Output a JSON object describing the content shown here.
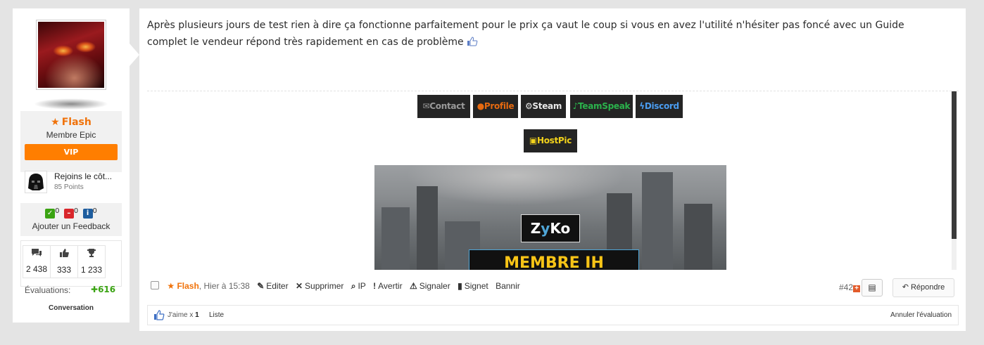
{
  "post": {
    "text": "Après plusieurs jours de test rien à dire ça fonctionne parfaitement pour le prix ça vaut le coup si vous en avez l'utilité n'hésiter pas foncé avec un Guide complet le vendeur répond très rapidement en cas de problème",
    "emoji": "thumbs-up"
  },
  "user": {
    "name": "Flash",
    "title": "Membre Epic",
    "badge": "VIP",
    "rank_label": "Rejoins le côt...",
    "rank_points": "85 Points",
    "feedback": {
      "positive": "0",
      "negative": "0",
      "neutral": "0",
      "link": "Ajouter un Feedback"
    },
    "stats": {
      "messages": "2 438",
      "likes": "333",
      "trophies": "1 233"
    },
    "evaluations_label": "Évaluations:",
    "evaluations_value": "616",
    "conversation": "Conversation"
  },
  "signature": {
    "buttons": [
      {
        "label": "Contact",
        "icon": "envelope-icon",
        "color": "#9a9a9a"
      },
      {
        "label": "Profile",
        "icon": "user-icon",
        "color": "#e66a10"
      },
      {
        "label": "Steam",
        "icon": "steam-icon",
        "color": "#e8e8e8"
      },
      {
        "label": "TeamSpeak",
        "icon": "microphone-icon",
        "color": "#2bb24c"
      },
      {
        "label": "Discord",
        "icon": "bolt-icon",
        "color": "#4a9cf0"
      },
      {
        "label": "HostPic",
        "icon": "image-icon",
        "color": "#f2d21b"
      }
    ],
    "banner_logo_pre": "Z",
    "banner_logo_mid": "y",
    "banner_logo_post": "Ko",
    "banner_text": "MEMBRE IH"
  },
  "actions": {
    "author": "Flash",
    "time": "Hier à 15:38",
    "edit": "Editer",
    "delete": "Supprimer",
    "ip": "IP",
    "warn": "Avertir",
    "report": "Signaler",
    "bookmark": "Signet",
    "ban": "Bannir",
    "post_number": "#42",
    "reply": "Répondre"
  },
  "likes": {
    "prefix": "J'aime x",
    "count": "1",
    "list": "Liste",
    "cancel": "Annuler l'évaluation"
  },
  "colors": {
    "accent_orange": "#f0720a",
    "vip": "#ff7e00",
    "positive_green": "#3aa312"
  }
}
